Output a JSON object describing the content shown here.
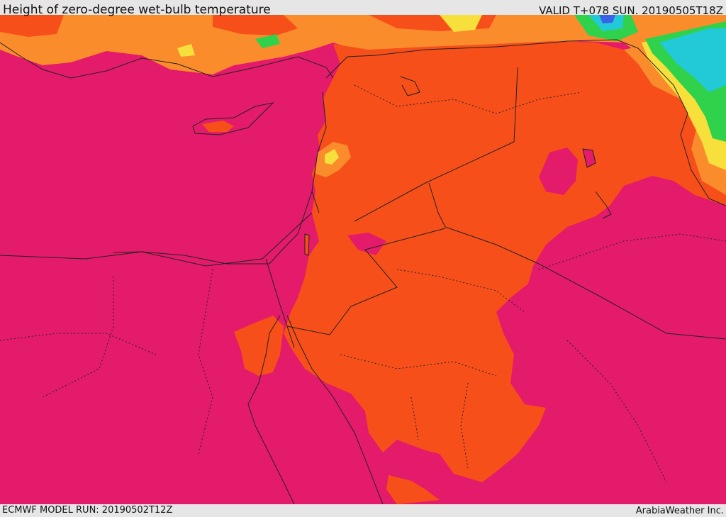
{
  "header": {
    "title": "Height of zero-degree wet-bulb temperature",
    "valid_time": "VALID T+078 SUN. 20190505T18Z"
  },
  "footer": {
    "model_run": "ECMWF MODEL RUN: 20190502T12Z",
    "credit": "ArabiaWeather Inc."
  },
  "map": {
    "region": "Eastern Mediterranean, Levant, Iraq, Egypt and northern Arabia",
    "colors": {
      "lowest_band": "#e41a6a",
      "low_band": "#f74f1a",
      "mid_band": "#fb8c2c",
      "yellow_band": "#f7e03c",
      "green_band": "#2fd24a",
      "cyan_band": "#22c9d6",
      "blue_band": "#3a62e8"
    }
  }
}
